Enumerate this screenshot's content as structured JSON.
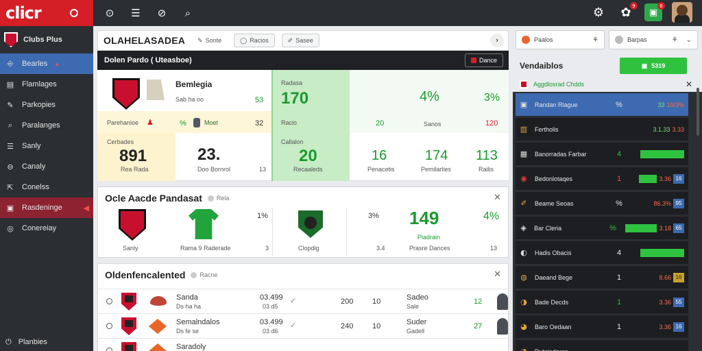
{
  "topbar": {
    "logo": "clicr",
    "icons": [
      "target-icon",
      "menu-icon",
      "clock-icon",
      "search-icon"
    ],
    "notif_count_1": "9",
    "notif_count_2": "6"
  },
  "sidebar": {
    "brand": "Clubs Plus",
    "items": [
      {
        "icon": "⎆",
        "label": "Bearles",
        "state": "active",
        "flag": "▲"
      },
      {
        "icon": "▤",
        "label": "Flamlages",
        "state": ""
      },
      {
        "icon": "✎",
        "label": "Parkopies",
        "state": ""
      },
      {
        "icon": "⌕",
        "label": "Paralanges",
        "state": ""
      },
      {
        "icon": "☰",
        "label": "Sanly",
        "state": ""
      },
      {
        "icon": "⊖",
        "label": "Canaly",
        "state": ""
      },
      {
        "icon": "⇱",
        "label": "Conelss",
        "state": ""
      },
      {
        "icon": "▣",
        "label": "Rasdeninge",
        "state": "alert"
      },
      {
        "icon": "◎",
        "label": "Conereiay",
        "state": ""
      }
    ],
    "bottom": "Planbies"
  },
  "main": {
    "title": "OLAHELASADEA",
    "chips": [
      "Sonte",
      "Racios",
      "Sasee"
    ],
    "darkbar_title": "Dolen Pardo ( Uteasboe)",
    "darkbar_chip": "Dance",
    "p1": {
      "team_name": "Bemlegia",
      "team_sub": "Sab ha oo",
      "v1": "53",
      "row2_label": "Parehanioe",
      "row2_pct": "%",
      "row2_tag": "Moet",
      "row2_val": "32",
      "left_lbl": "Cerbades",
      "left_big": "891",
      "left_sub": "Rea Rada",
      "mid_big": "23.",
      "mid_sub": "Doo Bornrol",
      "mid_val": "13",
      "green_lbl": "Radasa",
      "green_big": "170",
      "green_sub": "Racio",
      "green_lbl2": "Callalon",
      "green_big2": "20",
      "green_sub2": "Recaaleds",
      "pct1": "4%",
      "pct2": "3%",
      "n20": "20",
      "sonos": "Sanos",
      "n120": "120",
      "n16": "16",
      "r16": "Penacetis",
      "n174": "174",
      "r174": "Pemilarlies",
      "n113": "113",
      "r113": "Railis"
    },
    "p2": {
      "title": "Ocle Aacde Pandasat",
      "sub": "Rela",
      "team_a": "Saniy",
      "shirt_label": "Rama 9 Raderade",
      "pct_a": "1%",
      "val_a": "3",
      "team_b": "Clopdig",
      "pct_b": "3%",
      "val_b": "3.4",
      "big": "149",
      "big_sub": "Piadrain",
      "big_sub2": "Prasre Dances",
      "pct_c": "4%",
      "val_c": "13"
    },
    "p3": {
      "title": "Oldenfencalented",
      "sub": "Racne",
      "rows": [
        {
          "name": "Sanda",
          "sub": "Ds ha ha",
          "score": "03.499",
          "score2": "03 d5",
          "n1": "200",
          "n2": "10",
          "tag": "Sadeo",
          "tsub": "Sale",
          "last": "12"
        },
        {
          "name": "Semalndalos",
          "sub": "Ds fe se",
          "score": "03.499",
          "score2": "03 d6",
          "n1": "240",
          "n2": "10",
          "tag": "Suder",
          "tsub": "Gadell",
          "last": "27"
        },
        {
          "name": "Saradoly",
          "sub": "",
          "score": "",
          "score2": "",
          "n1": "",
          "n2": "",
          "tag": "",
          "tsub": "",
          "last": ""
        }
      ]
    }
  },
  "right": {
    "tab1": "Paalos",
    "tab2": "Barpas",
    "head": "Vendaiblos",
    "btn": "5319",
    "sub": "Aggdlosrad Chdds",
    "items": [
      {
        "icon": "▣",
        "label": "Randan Rlague",
        "cnt": "%",
        "cntc": "",
        "v1": "33",
        "v2": "10/3%",
        "tag": "",
        "bar": 0,
        "sel": true
      },
      {
        "icon": "▥",
        "label": "Fertholis",
        "cnt": "",
        "cntc": "",
        "v1": "3.1.33",
        "v2": "3.33",
        "tag": "",
        "bar": 0,
        "sel": false
      },
      {
        "icon": "▦",
        "label": "Banorradas Farbar",
        "cnt": "4",
        "cntc": "green",
        "v1": "",
        "v2": "",
        "tag": "",
        "bar": 64,
        "sel": false
      },
      {
        "icon": "◉",
        "label": "Bedonlotaqes",
        "cnt": "1",
        "cntc": "red",
        "v1": "",
        "v2": "3.36",
        "tag": "16",
        "bar": 26,
        "sel": false
      },
      {
        "icon": "✐",
        "label": "Beame Seoas",
        "cnt": "%",
        "cntc": "",
        "v1": "",
        "v2": "86.3%",
        "tag": "95",
        "bar": 0,
        "sel": false
      },
      {
        "icon": "◈",
        "label": "Bar Cleria",
        "cnt": "%",
        "cntc": "green",
        "v1": "",
        "v2": "3.18",
        "tag": "65",
        "bar": 46,
        "sel": false
      },
      {
        "icon": "◐",
        "label": "Hadis Obacis",
        "cnt": "4",
        "cntc": "",
        "v1": "",
        "v2": "",
        "tag": "",
        "bar": 64,
        "sel": false
      },
      {
        "icon": "◍",
        "label": "Daeand Bege",
        "cnt": "1",
        "cntc": "",
        "v1": "",
        "v2": "8.66",
        "tag": "16",
        "bar": 0,
        "sel": false
      },
      {
        "icon": "◑",
        "label": "Bade Decds",
        "cnt": "1",
        "cntc": "green",
        "v1": "",
        "v2": "3.36",
        "tag": "55",
        "bar": 0,
        "sel": false
      },
      {
        "icon": "◕",
        "label": "Baro Oedaan",
        "cnt": "1",
        "cntc": "",
        "v1": "",
        "v2": "3.36",
        "tag": "16",
        "bar": 0,
        "sel": false
      },
      {
        "icon": "◔",
        "label": "Dutainderes",
        "cnt": "",
        "cntc": "",
        "v1": "",
        "v2": "",
        "tag": "",
        "bar": 0,
        "sel": false
      }
    ]
  }
}
